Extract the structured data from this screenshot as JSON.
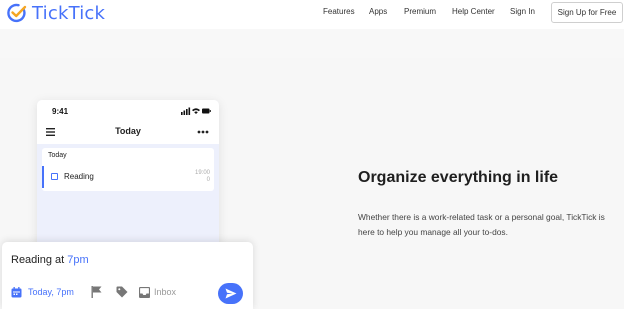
{
  "brand": {
    "name": "TickTick",
    "accent": "#4772fa"
  },
  "nav": {
    "links": [
      "Features",
      "Apps",
      "Premium",
      "Help Center",
      "Sign In"
    ],
    "signup_label": "Sign Up for Free"
  },
  "phone": {
    "time": "9:41",
    "header_title": "Today",
    "section_title": "Today",
    "task": {
      "label": "Reading",
      "time": "19:00"
    }
  },
  "quick_add": {
    "text": "Reading at ",
    "date_highlight": "7pm",
    "date_label": "Today, 7pm",
    "list_label": "Inbox"
  },
  "hero": {
    "title": "Organize everything in life",
    "description": "Whether there is a work-related task or a personal goal, TickTick is here to help you manage all your to-dos."
  }
}
